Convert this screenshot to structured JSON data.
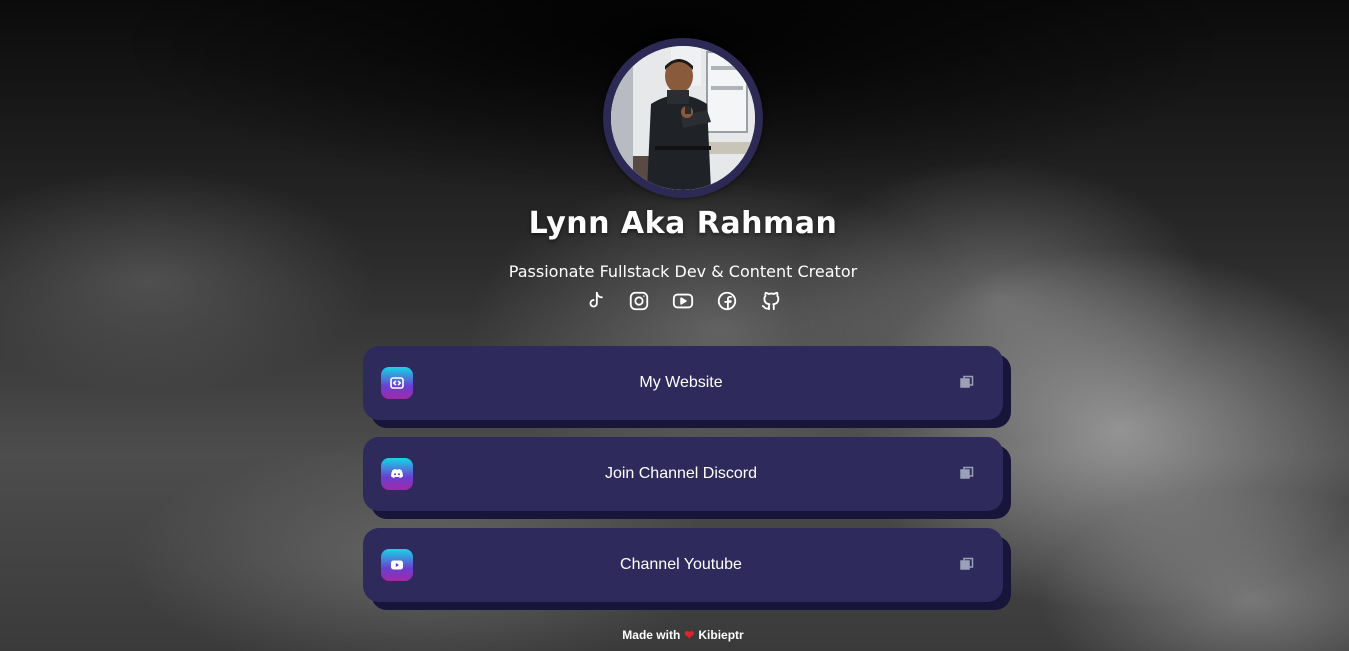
{
  "profile": {
    "name": "Lynn Aka Rahman",
    "bio": "Passionate Fullstack Dev & Content Creator",
    "avatar": "profile-photo"
  },
  "socials": [
    {
      "name": "tiktok",
      "icon": "tiktok-icon"
    },
    {
      "name": "instagram",
      "icon": "instagram-icon"
    },
    {
      "name": "youtube",
      "icon": "youtube-icon"
    },
    {
      "name": "facebook",
      "icon": "facebook-icon"
    },
    {
      "name": "github",
      "icon": "github-icon"
    }
  ],
  "links": [
    {
      "label": "My Website",
      "icon": "code-icon"
    },
    {
      "label": "Join Channel Discord",
      "icon": "discord-icon"
    },
    {
      "label": "Channel Youtube",
      "icon": "youtube-icon"
    }
  ],
  "footer": {
    "prefix": "Made with",
    "heart": "❤",
    "author": "Kibieptr"
  },
  "colors": {
    "card": "#2e2b5c",
    "card_shadow": "#17153a",
    "heart": "#e3232c"
  }
}
